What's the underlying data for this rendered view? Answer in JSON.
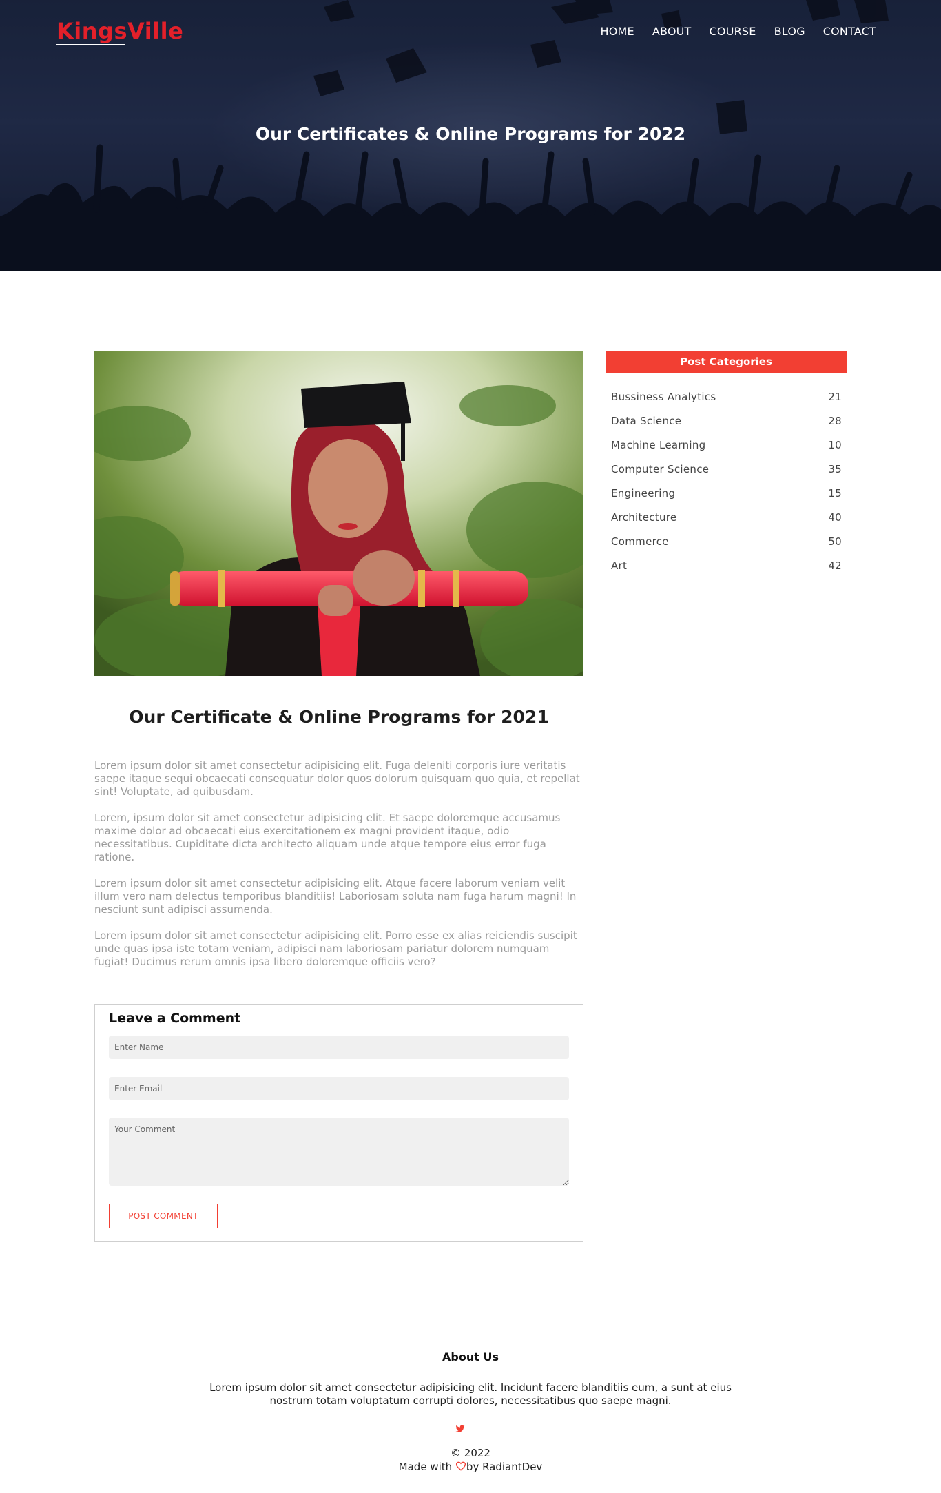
{
  "header": {
    "logo": "KingsVille",
    "nav": [
      "HOME",
      "ABOUT",
      "COURSE",
      "BLOG",
      "CONTACT"
    ],
    "hero_title": "Our Certificates & Online Programs for 2022"
  },
  "post": {
    "title": "Our Certificate & Online Programs for 2021",
    "paragraphs": [
      "Lorem ipsum dolor sit amet consectetur adipisicing elit. Fuga deleniti corporis iure veritatis saepe itaque sequi obcaecati consequatur dolor quos dolorum quisquam quo quia, et repellat sint! Voluptate, ad quibusdam.",
      "Lorem, ipsum dolor sit amet consectetur adipisicing elit. Et saepe doloremque accusamus maxime dolor ad obcaecati eius exercitationem ex magni provident itaque, odio necessitatibus. Cupiditate dicta architecto aliquam unde atque tempore eius error fuga ratione.",
      "Lorem ipsum dolor sit amet consectetur adipisicing elit. Atque facere laborum veniam velit illum vero nam delectus temporibus blanditiis! Laboriosam soluta nam fuga harum magni! In nesciunt sunt adipisci assumenda.",
      "Lorem ipsum dolor sit amet consectetur adipisicing elit. Porro esse ex alias reiciendis suscipit unde quas ipsa iste totam veniam, adipisci nam laboriosam pariatur dolorem numquam fugiat! Ducimus rerum omnis ipsa libero doloremque officiis vero?"
    ]
  },
  "comment_form": {
    "title": "Leave a Comment",
    "name_placeholder": "Enter Name",
    "email_placeholder": "Enter Email",
    "comment_placeholder": "Your Comment",
    "submit_label": "POST COMMENT"
  },
  "sidebar": {
    "header": "Post Categories",
    "categories": [
      {
        "name": "Bussiness Analytics",
        "count": "21"
      },
      {
        "name": "Data Science",
        "count": "28"
      },
      {
        "name": "Machine Learning",
        "count": "10"
      },
      {
        "name": "Computer Science",
        "count": "35"
      },
      {
        "name": "Engineering",
        "count": "15"
      },
      {
        "name": "Architecture",
        "count": "40"
      },
      {
        "name": "Commerce",
        "count": "50"
      },
      {
        "name": "Art",
        "count": "42"
      }
    ]
  },
  "footer": {
    "title": "About Us",
    "text": "Lorem ipsum dolor sit amet consectetur adipisicing elit. Incidunt facere blanditiis eum, a sunt at eius nostrum totam voluptatum corrupti dolores, necessitatibus quo saepe magni.",
    "copyright": "© 2022",
    "made_prefix": "Made with ",
    "made_suffix": "by RadiantDev"
  },
  "colors": {
    "accent": "#f23f33",
    "logo": "#e3202a",
    "hero_bg": "#1f2a44",
    "body_text": "#9a9a9a"
  },
  "icons": [
    "twitter-icon",
    "heart-icon"
  ]
}
